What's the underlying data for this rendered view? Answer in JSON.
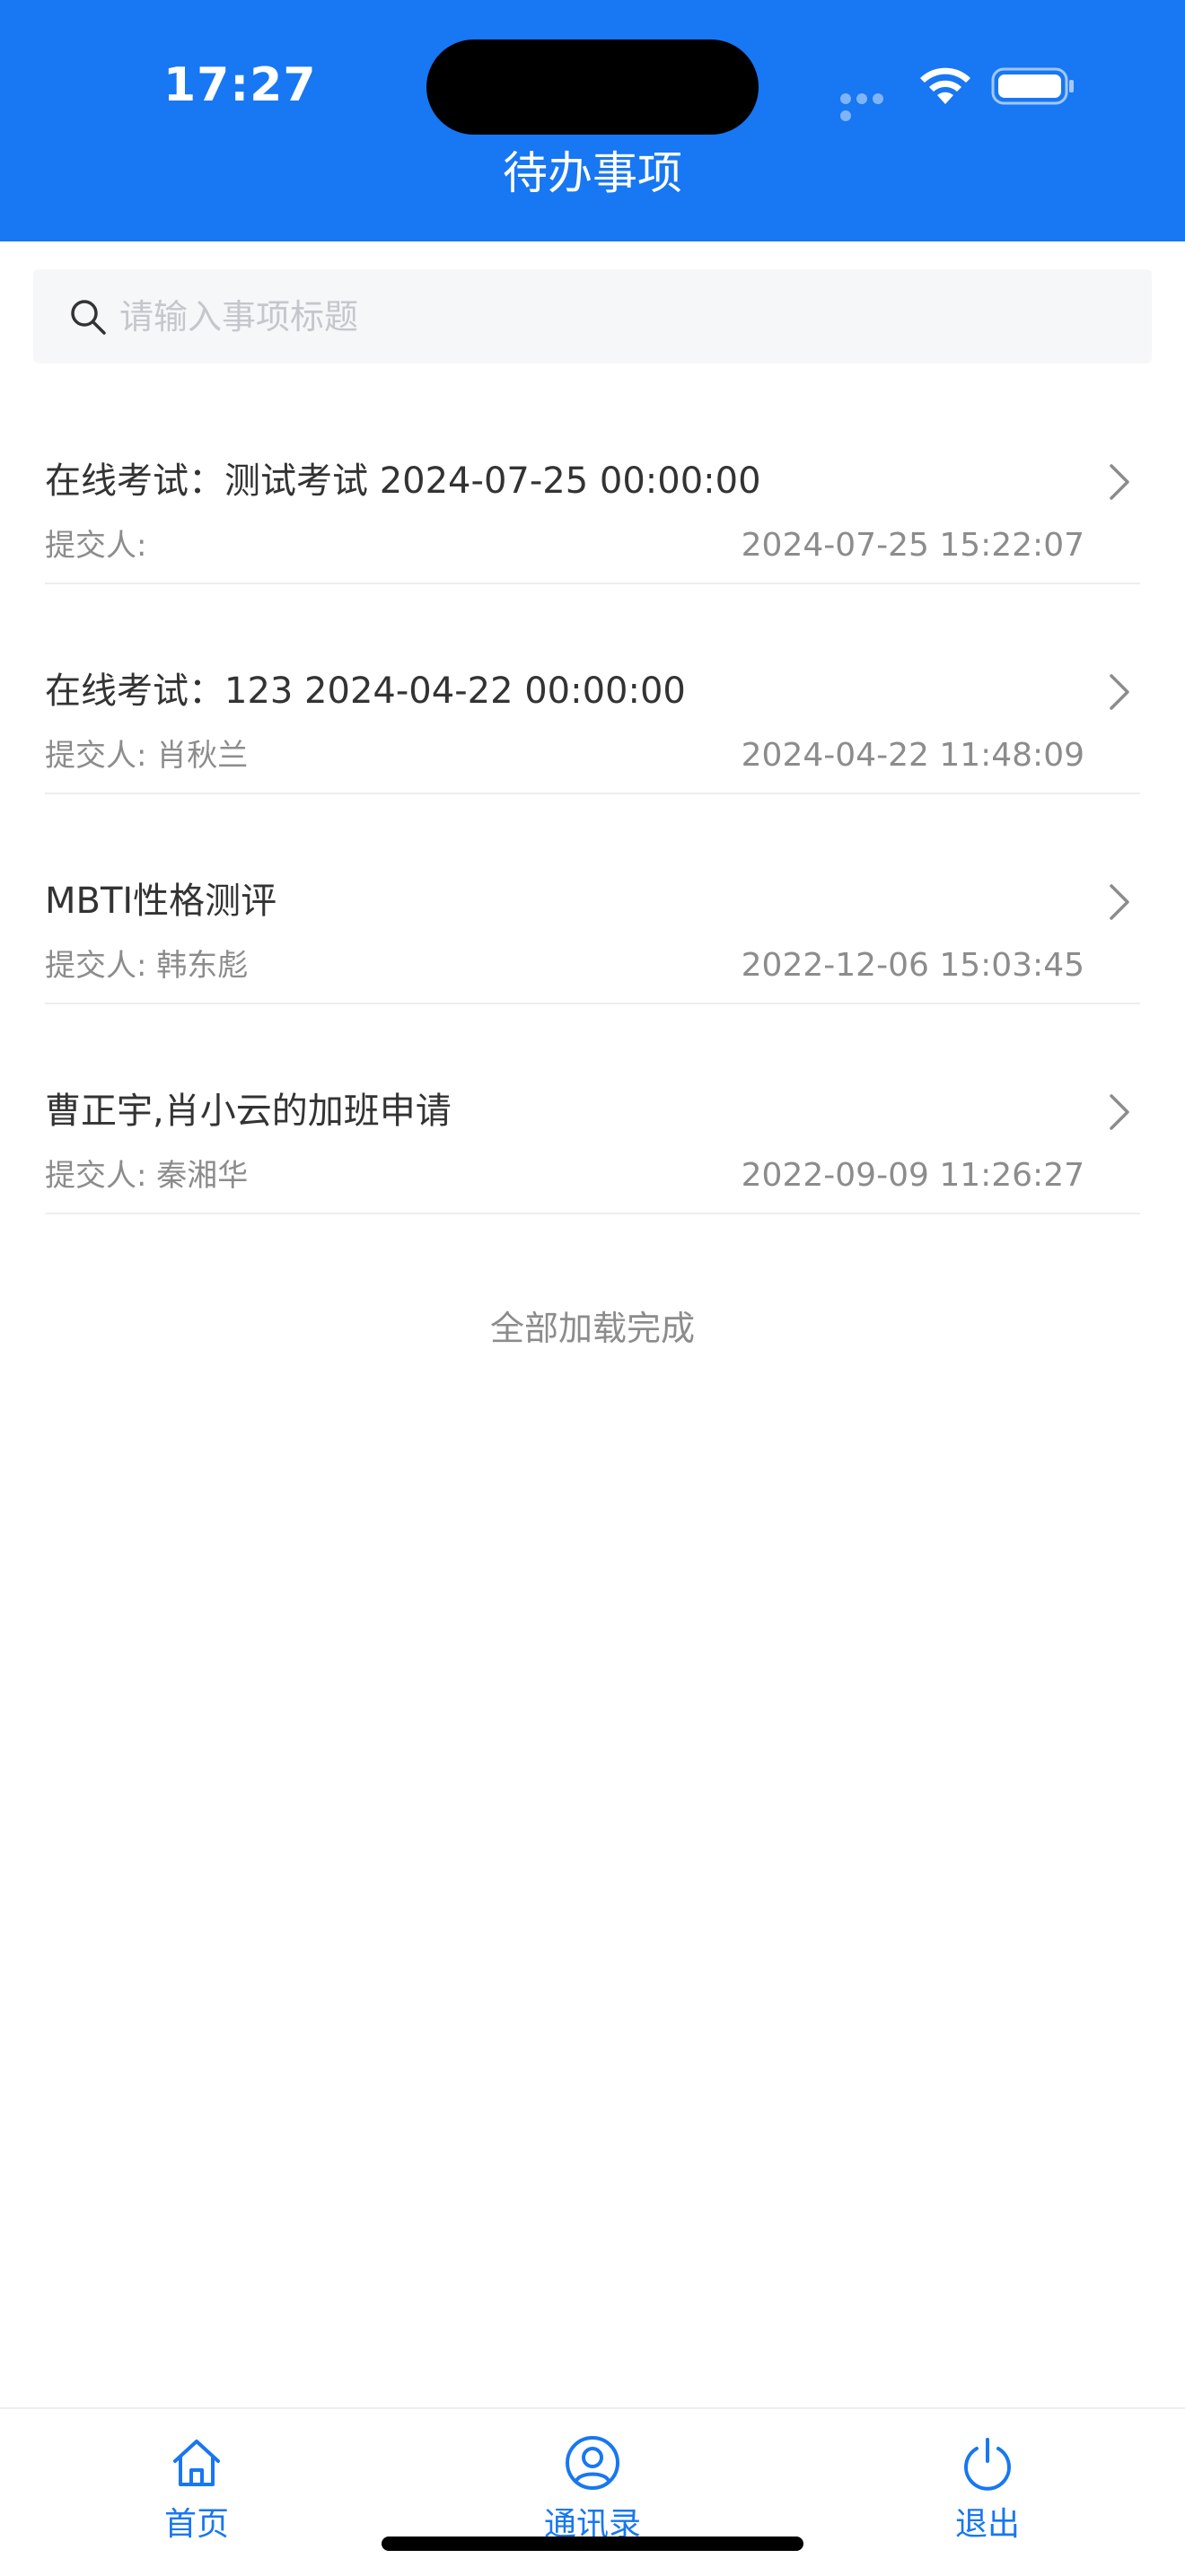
{
  "status_bar": {
    "time": "17:27"
  },
  "header": {
    "title": "待办事项"
  },
  "search": {
    "placeholder": "请输入事项标题",
    "value": ""
  },
  "todos": [
    {
      "title": "在线考试：测试考试 2024-07-25 00:00:00",
      "submitter": "提交人:",
      "time": "2024-07-25 15:22:07"
    },
    {
      "title": "在线考试：123 2024-04-22 00:00:00",
      "submitter": "提交人: 肖秋兰",
      "time": "2024-04-22 11:48:09"
    },
    {
      "title": "MBTI性格测评",
      "submitter": "提交人: 韩东彪",
      "time": "2022-12-06 15:03:45"
    },
    {
      "title": "曹正宇,肖小云的加班申请",
      "submitter": "提交人: 秦湘华",
      "time": "2022-09-09 11:26:27"
    }
  ],
  "list_footer": "全部加载完成",
  "tab_bar": {
    "items": [
      {
        "label": "首页",
        "icon": "home-icon"
      },
      {
        "label": "通讯录",
        "icon": "contacts-icon"
      },
      {
        "label": "退出",
        "icon": "power-icon"
      }
    ]
  },
  "colors": {
    "primary": "#1877f2",
    "text": "#333333",
    "muted": "#8c8c8c",
    "search_bg": "#f6f7f9"
  }
}
